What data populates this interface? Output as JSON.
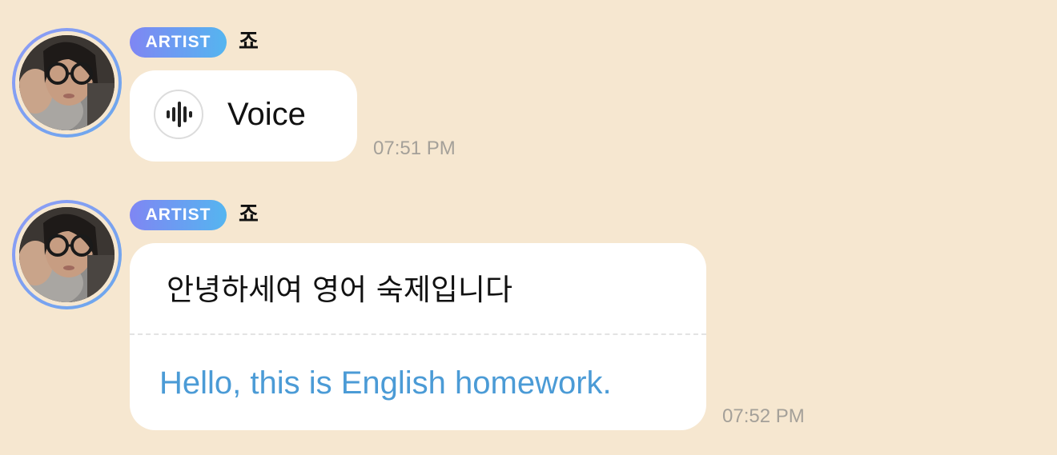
{
  "messages": [
    {
      "badge": "ARTIST",
      "sender": "죠",
      "type": "voice",
      "voice_label": "Voice",
      "time": "07:51 PM"
    },
    {
      "badge": "ARTIST",
      "sender": "죠",
      "type": "text",
      "text": "안녕하세여 영어 숙제입니다",
      "translation": "Hello, this is English homework.",
      "time": "07:52 PM"
    }
  ],
  "colors": {
    "background": "#f6e7d0",
    "badge_gradient_start": "#7f86f3",
    "badge_gradient_end": "#55b5f0",
    "translation_text": "#4b9bd6",
    "timestamp": "#a4a099"
  },
  "icons": [
    "voice-waveform-icon"
  ]
}
